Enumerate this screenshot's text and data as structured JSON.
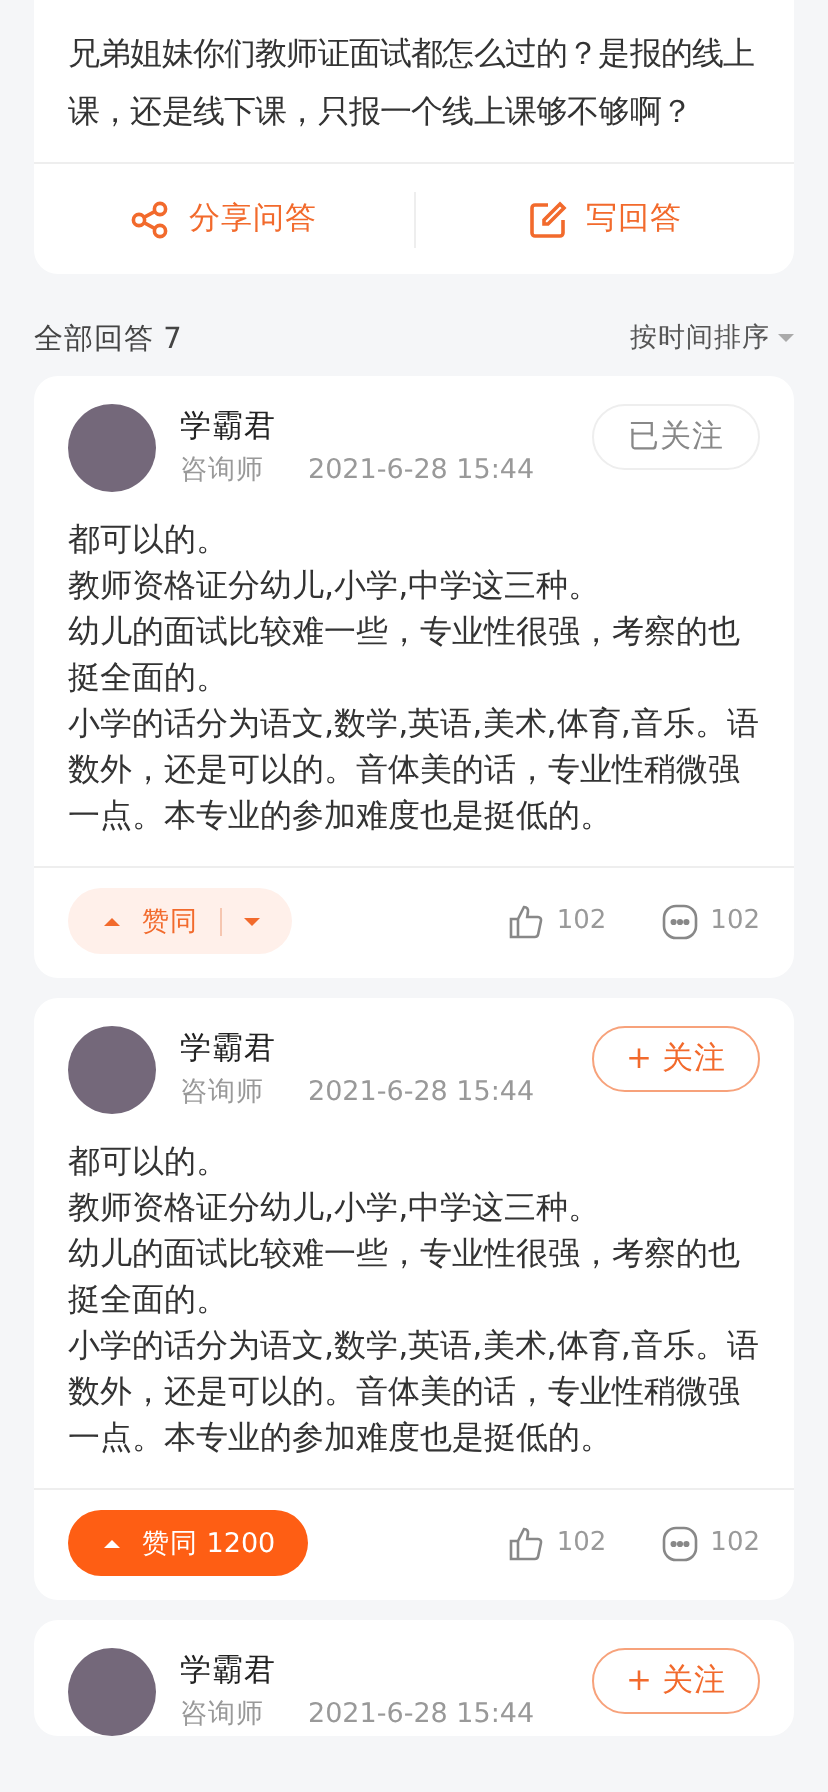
{
  "question": {
    "text": "兄弟姐妹你们教师证面试都怎么过的？是报的线上课，还是线下课，只报一个线上课够不够啊？",
    "actions": [
      {
        "kind": "share",
        "label": "分享问答"
      },
      {
        "kind": "write",
        "label": "写回答"
      }
    ]
  },
  "answers_header": {
    "title": "全部回答 7",
    "sort": "按时间排序"
  },
  "answers": [
    {
      "name": "学霸君",
      "role": "咨询师",
      "time": "2021-6-28 15:44",
      "follow": {
        "label": "已关注",
        "followed": true
      },
      "paragraphs": [
        "都可以的。",
        "教师资格证分幼儿,小学,中学这三种。",
        "幼儿的面试比较难一些，专业性很强，考察的也挺全面的。",
        "小学的话分为语文,数学,英语,美术,体育,音乐。语数外，还是可以的。音体美的话，专业性稍微强一点。本专业的参加难度也是挺低的。"
      ],
      "agree": {
        "label": "赞同",
        "agreed": false
      },
      "likes": "102",
      "comments": "102"
    },
    {
      "name": "学霸君",
      "role": "咨询师",
      "time": "2021-6-28 15:44",
      "follow": {
        "label": "+ 关注",
        "followed": false
      },
      "paragraphs": [
        "都可以的。",
        "教师资格证分幼儿,小学,中学这三种。",
        "幼儿的面试比较难一些，专业性很强，考察的也挺全面的。",
        "小学的话分为语文,数学,英语,美术,体育,音乐。语数外，还是可以的。音体美的话，专业性稍微强一点。本专业的参加难度也是挺低的。"
      ],
      "agree": {
        "label": "赞同 1200",
        "agreed": true
      },
      "likes": "102",
      "comments": "102"
    },
    {
      "name": "学霸君",
      "role": "咨询师",
      "time": "2021-6-28 15:44",
      "follow": {
        "label": "+ 关注",
        "followed": false
      }
    }
  ]
}
